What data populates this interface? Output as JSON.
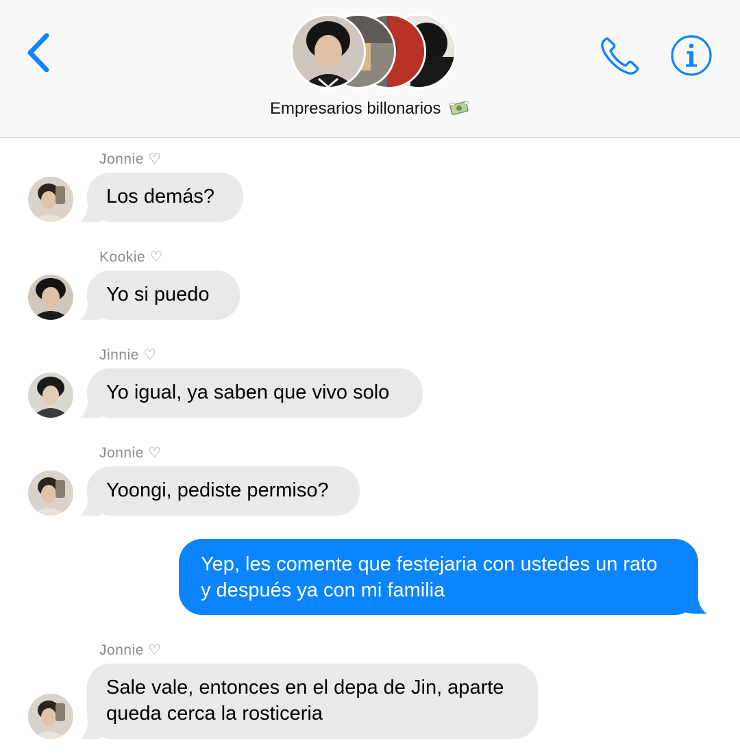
{
  "header": {
    "group_name": "Empresarios billonarios",
    "group_emoji_icon": "money-with-wings-icon",
    "back_icon": "chevron-left-icon",
    "call_icon": "phone-icon",
    "info_icon": "info-icon"
  },
  "colors": {
    "accent": "#0b84fe",
    "incoming_bubble": "#e9e9eb",
    "sender_name": "#8a8a8e",
    "header_bg": "#f8f8f9"
  },
  "messages": [
    {
      "sender": "Jonnie ♡",
      "text": "Los demás?",
      "direction": "incoming"
    },
    {
      "sender": "Kookie ♡",
      "text": "Yo si puedo",
      "direction": "incoming"
    },
    {
      "sender": "Jinnie ♡",
      "text": "Yo igual, ya saben que vivo solo",
      "direction": "incoming"
    },
    {
      "sender": "Jonnie ♡",
      "text": "Yoongi, pediste permiso?",
      "direction": "incoming"
    },
    {
      "text": "Yep, les comente que festejaria con ustedes un rato\ny después ya con mi familia",
      "direction": "outgoing"
    },
    {
      "sender": "Jonnie ♡",
      "text": "Sale vale, entonces en el depa de Jin, aparte\nqueda cerca la rosticeria",
      "direction": "incoming"
    }
  ]
}
